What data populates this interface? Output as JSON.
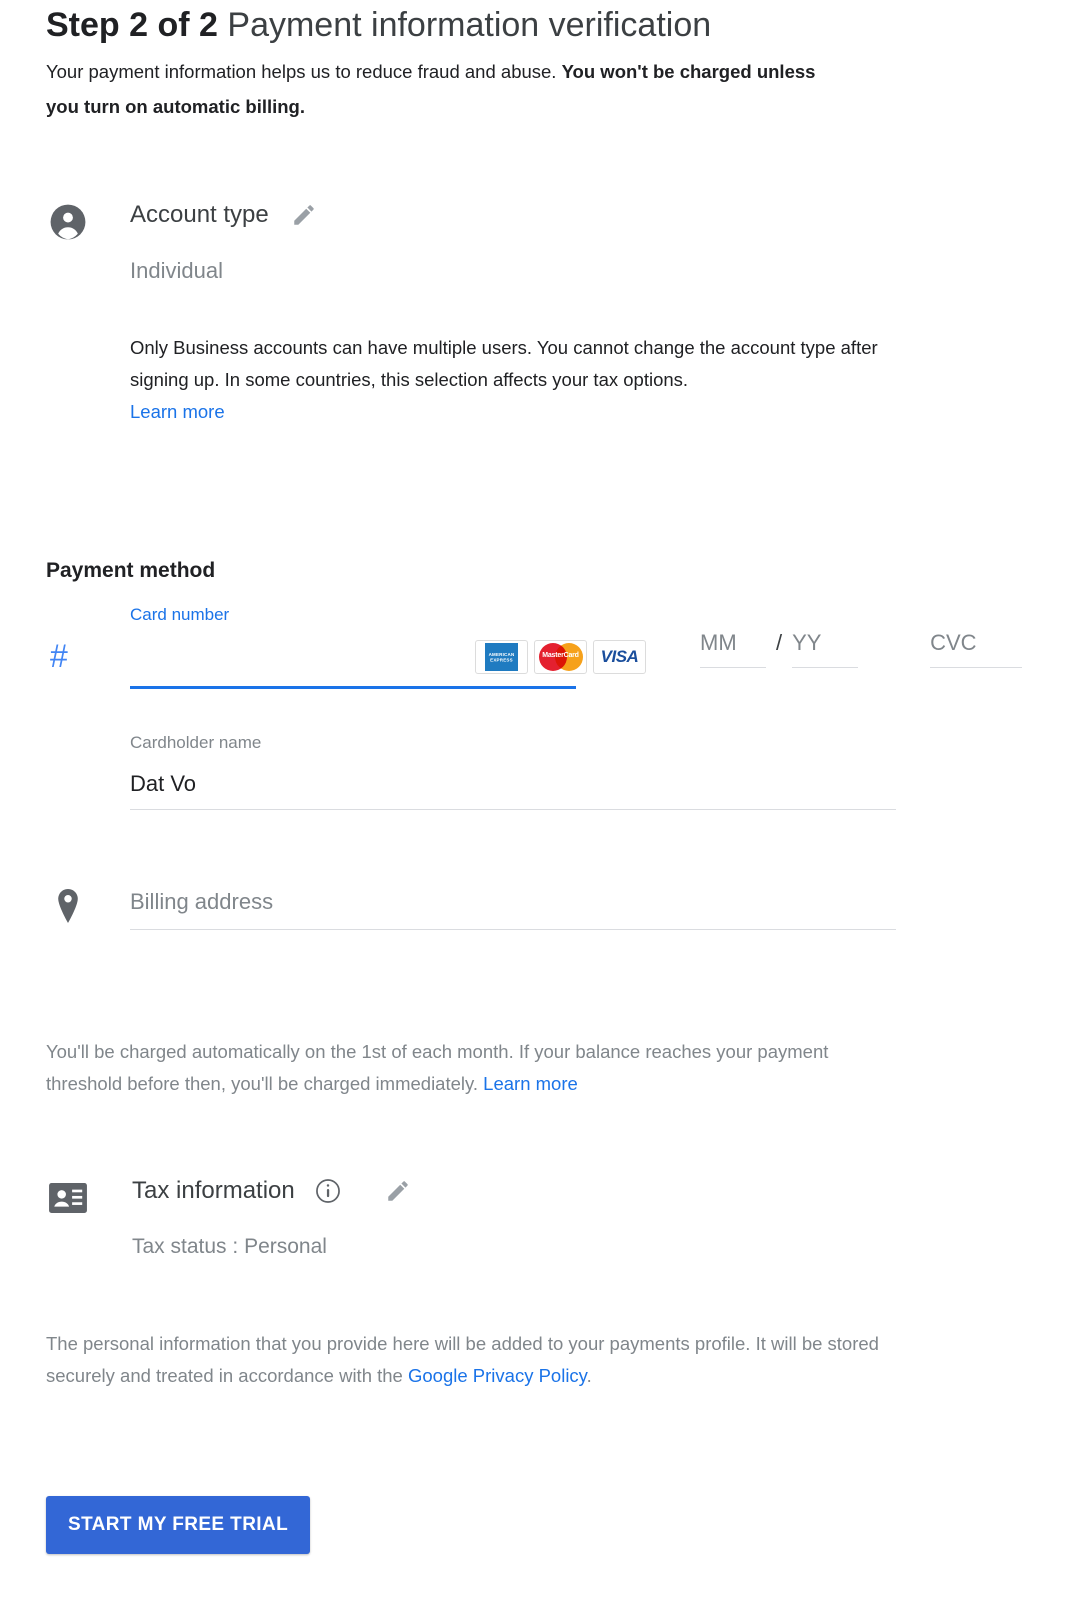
{
  "header": {
    "step_label": "Step 2 of 2",
    "title": "Payment information verification",
    "subtitle_plain": "Your payment information helps us to reduce fraud and abuse. ",
    "subtitle_bold": "You won't be charged unless you turn on automatic billing."
  },
  "account_type": {
    "icon": "person-icon",
    "title": "Account type",
    "edit_icon": "pencil-icon",
    "value": "Individual",
    "description": "Only Business accounts can have multiple users. You cannot change the account type after signing up. In some countries, this selection affects your tax options. ",
    "learn_more": "Learn more"
  },
  "payment_method": {
    "section_title": "Payment method",
    "number_icon": "#",
    "card_number_label": "Card number",
    "card_number_value": "",
    "card_number_placeholder": "",
    "brands": [
      {
        "name": "amex-logo",
        "text": "AMERICAN EXPRESS"
      },
      {
        "name": "mastercard-logo",
        "text": "MasterCard"
      },
      {
        "name": "visa-logo",
        "text": "VISA"
      }
    ],
    "exp_month_placeholder": "MM",
    "exp_month_value": "",
    "exp_separator": "/",
    "exp_year_placeholder": "YY",
    "exp_year_value": "",
    "cvc_placeholder": "CVC",
    "cvc_value": "",
    "cardholder_label": "Cardholder name",
    "cardholder_value": "Dat Vo"
  },
  "billing": {
    "icon": "location-pin-icon",
    "placeholder": "Billing address",
    "value": ""
  },
  "notice": {
    "text": "You'll be charged automatically on the 1st of each month. If your balance reaches your payment threshold before then, you'll be charged immediately. ",
    "learn_more": "Learn more"
  },
  "tax": {
    "icon": "contact-card-icon",
    "title": "Tax information",
    "info_icon": "info-icon",
    "edit_icon": "pencil-icon",
    "status_label": "Tax status",
    "status_separator": " : ",
    "status_value": "Personal"
  },
  "privacy": {
    "text": "The personal information that you provide here will be added to your payments profile. It will be stored securely and treated in accordance with the ",
    "link": "Google Privacy Policy",
    "tail": "."
  },
  "cta": {
    "label": "START MY FREE TRIAL"
  },
  "colors": {
    "accent_blue": "#1a73e8",
    "icon_blue": "#4285f4",
    "button_blue": "#3367d6",
    "muted_gray": "#80868b",
    "text_dark": "#202124"
  }
}
